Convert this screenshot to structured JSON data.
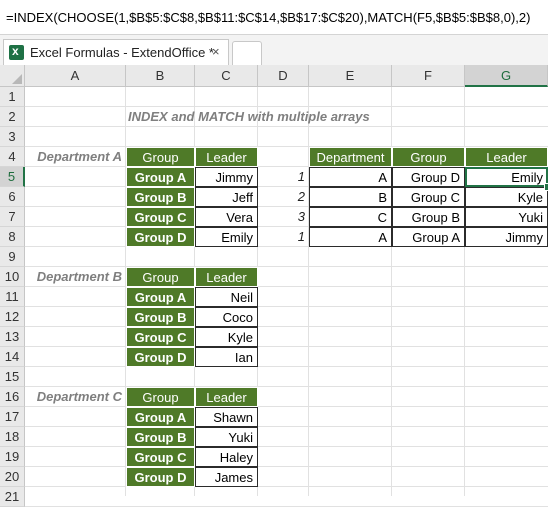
{
  "formula_bar": {
    "formula": "=INDEX(CHOOSE(1,$B$5:$C$8,$B$11:$C$14,$B$17:$C$20),MATCH(F5,$B$5:$B$8,0),2)"
  },
  "tab": {
    "title": "Excel Formulas - ExtendOffice *",
    "close": "×"
  },
  "columns": [
    "A",
    "B",
    "C",
    "D",
    "E",
    "F",
    "G"
  ],
  "rows": [
    "1",
    "2",
    "3",
    "4",
    "5",
    "6",
    "7",
    "8",
    "9",
    "10",
    "11",
    "12",
    "13",
    "14",
    "15",
    "16",
    "17",
    "18",
    "19",
    "20",
    "21"
  ],
  "sheet_title": "INDEX and MATCH with multiple arrays",
  "departments": [
    {
      "label": "Department A",
      "header": [
        "Group",
        "Leader"
      ],
      "rows": [
        [
          "Group A",
          "Jimmy"
        ],
        [
          "Group B",
          "Jeff"
        ],
        [
          "Group C",
          "Vera"
        ],
        [
          "Group D",
          "Emily"
        ]
      ]
    },
    {
      "label": "Department B",
      "header": [
        "Group",
        "Leader"
      ],
      "rows": [
        [
          "Group A",
          "Neil"
        ],
        [
          "Group B",
          "Coco"
        ],
        [
          "Group C",
          "Kyle"
        ],
        [
          "Group D",
          "Ian"
        ]
      ]
    },
    {
      "label": "Department C",
      "header": [
        "Group",
        "Leader"
      ],
      "rows": [
        [
          "Group A",
          "Shawn"
        ],
        [
          "Group B",
          "Yuki"
        ],
        [
          "Group C",
          "Haley"
        ],
        [
          "Group D",
          "James"
        ]
      ]
    }
  ],
  "lookup": {
    "header": [
      "Department",
      "Group",
      "Leader"
    ],
    "index": [
      "1",
      "2",
      "3",
      "1"
    ],
    "rows": [
      [
        "A",
        "Group D",
        "Emily"
      ],
      [
        "B",
        "Group C",
        "Kyle"
      ],
      [
        "C",
        "Group B",
        "Yuki"
      ],
      [
        "A",
        "Group A",
        "Jimmy"
      ]
    ]
  },
  "colors": {
    "header_green": "#4f7a28",
    "excel_green": "#217346"
  }
}
